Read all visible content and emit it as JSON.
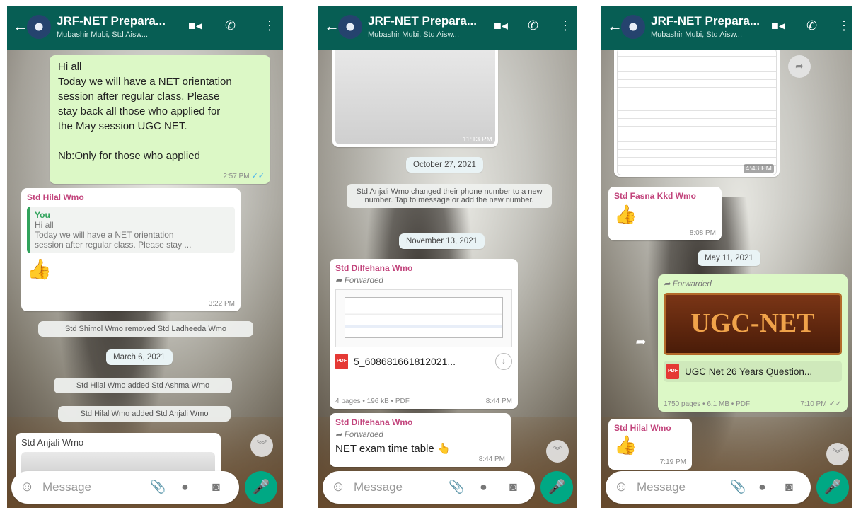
{
  "chat": {
    "title": "JRF-NET Prepara...",
    "subtitle": "Mubashir Mubi, Std Aisw..."
  },
  "input": {
    "placeholder": "Message"
  },
  "screen1": {
    "msg1": {
      "lines": [
        "Hi all",
        "Today we will have a NET orientation",
        "session after regular class. Please",
        "stay back all those who  applied for",
        "the May session UGC NET.",
        "",
        "Nb:Only for those who applied"
      ],
      "time": "2:57 PM",
      "ticks": "✓✓"
    },
    "msg2": {
      "sender": "Std Hilal Wmo",
      "quote_name": "You",
      "quote_line1": "Hi all",
      "quote_line2": "Today we will have a NET orientation",
      "quote_line3": "session after regular class. Please stay ...",
      "emoji": "👍",
      "time": "3:22 PM"
    },
    "system1": "Std Shimol Wmo removed Std Ladheeda Wmo",
    "date1": "March 6, 2021",
    "system2": "Std Hilal Wmo added Std Ashma Wmo",
    "system3": "Std Hilal Wmo added Std Anjali Wmo",
    "msg3": {
      "sender": "Std Anjali Wmo"
    }
  },
  "screen2": {
    "img_time": "11:13 PM",
    "date1": "October 27, 2021",
    "system1": "Std Anjali Wmo changed their phone number to a new number. Tap to message or add the new number.",
    "date2": "November 13, 2021",
    "doc": {
      "sender": "Std Dilfehana Wmo",
      "forwarded": "Forwarded",
      "filename": "5_6086816618120​21...",
      "meta": "4 pages • 196 kB • PDF",
      "time": "8:44 PM"
    },
    "msg2": {
      "sender": "Std Dilfehana Wmo",
      "forwarded": "Forwarded",
      "text": "NET exam time table 👆",
      "time": "8:44 PM"
    }
  },
  "screen3": {
    "img_time": "4:43 PM",
    "msg1": {
      "sender": "Std Fasna Kkd Wmo",
      "emoji": "👍",
      "time": "8:08 PM"
    },
    "date1": "May 11, 2021",
    "doc": {
      "forwarded": "Forwarded",
      "banner": "UGC-NET",
      "filename": "UGC Net 26 Years Question...",
      "meta": "1750 pages • 6.1 MB • PDF",
      "time": "7:10 PM",
      "ticks": "✓✓"
    },
    "msg2": {
      "sender": "Std Hilal Wmo",
      "emoji": "👍",
      "time": "7:19 PM"
    }
  }
}
